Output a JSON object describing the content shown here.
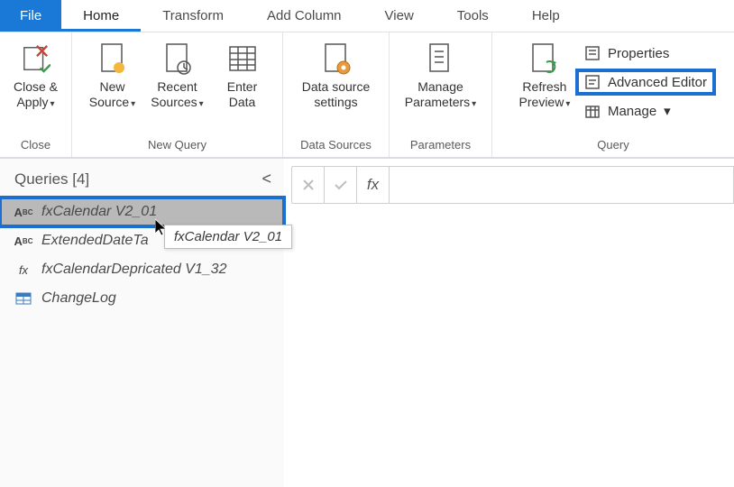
{
  "tabs": {
    "file": "File",
    "home": "Home",
    "transform": "Transform",
    "add_column": "Add Column",
    "view": "View",
    "tools": "Tools",
    "help": "Help"
  },
  "ribbon": {
    "close": {
      "close_apply": "Close &\nApply",
      "group": "Close"
    },
    "new_query": {
      "new_source": "New\nSource",
      "recent_sources": "Recent\nSources",
      "enter_data": "Enter\nData",
      "group": "New Query"
    },
    "data_sources": {
      "data_source_settings": "Data source\nsettings",
      "group": "Data Sources"
    },
    "parameters": {
      "manage_parameters": "Manage\nParameters",
      "group": "Parameters"
    },
    "query": {
      "refresh_preview": "Refresh\nPreview",
      "properties": "Properties",
      "advanced_editor": "Advanced Editor",
      "manage": "Manage",
      "group": "Query"
    }
  },
  "queries_panel": {
    "header": "Queries [4]",
    "items": [
      {
        "name": "fxCalendar V2_01",
        "icon": "abc"
      },
      {
        "name": "ExtendedDateTa",
        "icon": "abc"
      },
      {
        "name": "fxCalendarDepricated V1_32",
        "icon": "fx"
      },
      {
        "name": "ChangeLog",
        "icon": "table"
      }
    ],
    "tooltip": "fxCalendar V2_01"
  },
  "formula_bar": {
    "fx": "fx",
    "value": ""
  }
}
